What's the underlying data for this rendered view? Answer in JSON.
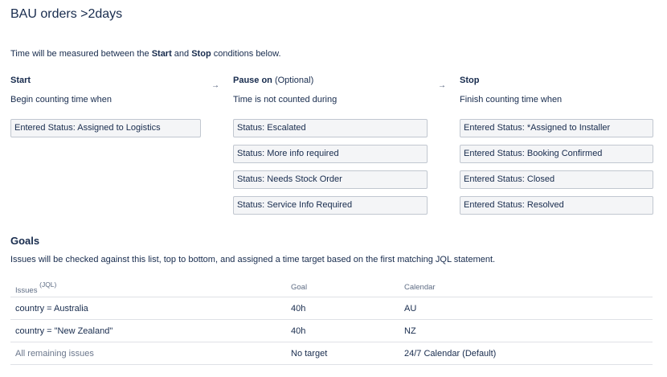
{
  "title": "BAU orders >2days",
  "intro": {
    "prefix": "Time will be measured between the ",
    "start_word": "Start",
    "and_word": " and ",
    "stop_word": "Stop",
    "suffix": " conditions below."
  },
  "arrow_glyph": "→",
  "start": {
    "heading": "Start",
    "subtitle": "Begin counting time when",
    "conditions": [
      "Entered Status: Assigned to Logistics"
    ]
  },
  "pause": {
    "heading": "Pause on",
    "heading_note": " (Optional)",
    "subtitle": "Time is not counted during",
    "conditions": [
      "Status: Escalated",
      "Status: More info required",
      "Status: Needs Stock Order",
      "Status: Service Info Required"
    ]
  },
  "stop": {
    "heading": "Stop",
    "subtitle": "Finish counting time when",
    "conditions": [
      "Entered Status: *Assigned to Installer",
      "Entered Status: Booking Confirmed",
      "Entered Status: Closed",
      "Entered Status: Resolved"
    ]
  },
  "goals": {
    "title": "Goals",
    "description": "Issues will be checked against this list, top to bottom, and assigned a time target based on the first matching JQL statement.",
    "headers": {
      "issues": "Issues",
      "issues_note": "(JQL)",
      "goal": "Goal",
      "calendar": "Calendar"
    },
    "rows": [
      {
        "issues": "country = Australia",
        "goal": "40h",
        "calendar": "AU"
      },
      {
        "issues": "country = \"New Zealand\"",
        "goal": "40h",
        "calendar": "NZ"
      },
      {
        "issues": "All remaining issues",
        "goal": "No target",
        "calendar": "24/7 Calendar (Default)"
      }
    ]
  }
}
